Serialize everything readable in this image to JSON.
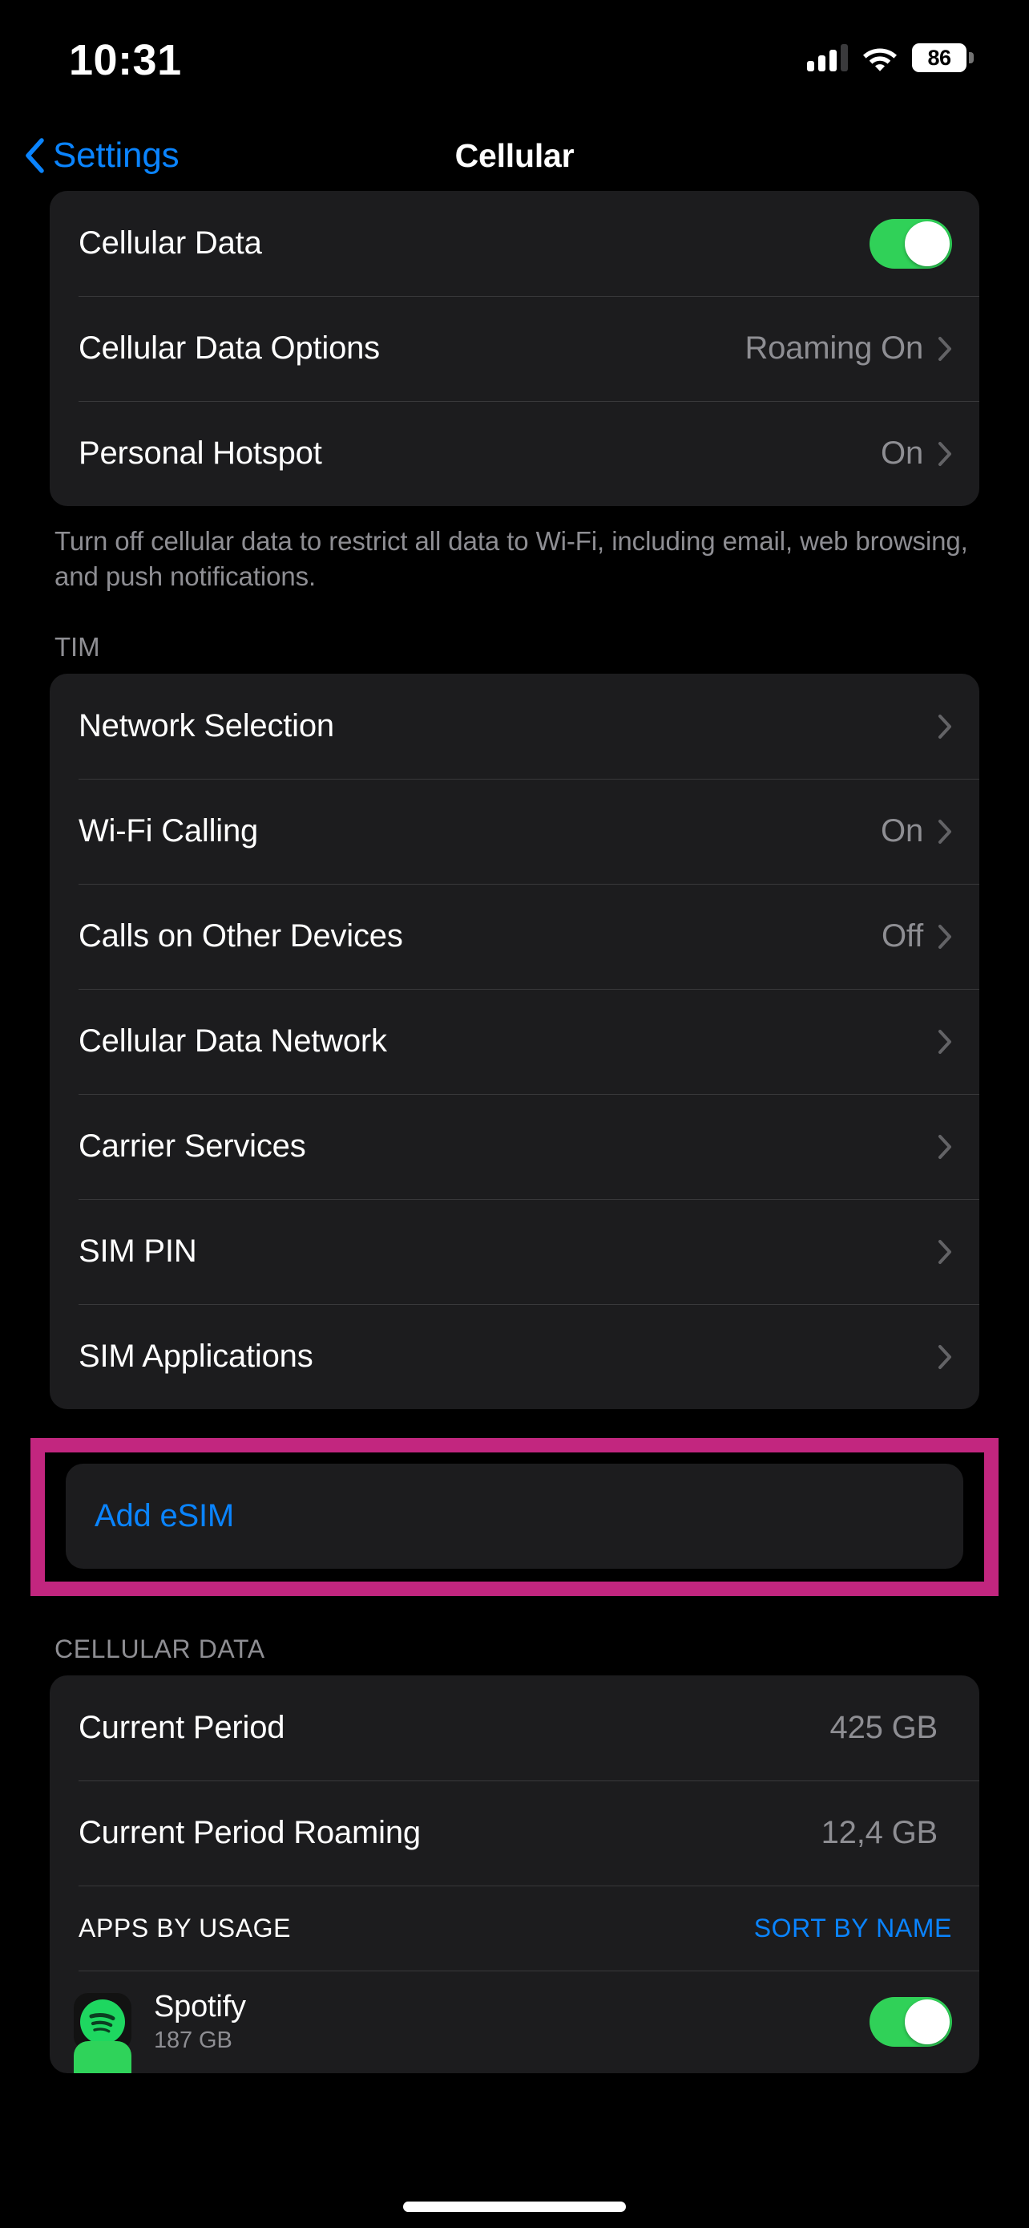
{
  "status_bar": {
    "time": "10:31",
    "battery_level": "86",
    "signal_icon": "cellular-bars-icon",
    "wifi_icon": "wifi-icon",
    "battery_icon": "battery-icon"
  },
  "nav": {
    "back_label": "Settings",
    "title": "Cellular",
    "back_icon": "chevron-left-icon"
  },
  "groups": {
    "data": {
      "rows": [
        {
          "label": "Cellular Data",
          "type": "toggle",
          "toggle_on": true
        },
        {
          "label": "Cellular Data Options",
          "value": "Roaming On",
          "type": "disclosure"
        },
        {
          "label": "Personal Hotspot",
          "value": "On",
          "type": "disclosure"
        }
      ],
      "footnote": "Turn off cellular data to restrict all data to Wi-Fi, including email, web browsing, and push notifications."
    },
    "carrier": {
      "header": "TIM",
      "rows": [
        {
          "label": "Network Selection",
          "value": "",
          "type": "disclosure"
        },
        {
          "label": "Wi-Fi Calling",
          "value": "On",
          "type": "disclosure"
        },
        {
          "label": "Calls on Other Devices",
          "value": "Off",
          "type": "disclosure"
        },
        {
          "label": "Cellular Data Network",
          "value": "",
          "type": "disclosure"
        },
        {
          "label": "Carrier Services",
          "value": "",
          "type": "disclosure"
        },
        {
          "label": "SIM PIN",
          "value": "",
          "type": "disclosure"
        },
        {
          "label": "SIM Applications",
          "value": "",
          "type": "disclosure"
        }
      ]
    },
    "add_esim": {
      "label": "Add eSIM",
      "highlight_color": "#c2267f"
    },
    "cellular_data": {
      "header": "CELLULAR DATA",
      "rows": [
        {
          "label": "Current Period",
          "value": "425 GB"
        },
        {
          "label": "Current Period Roaming",
          "value": "12,4 GB"
        }
      ],
      "usage_header": {
        "left": "APPS BY USAGE",
        "right": "SORT BY NAME"
      },
      "apps": [
        {
          "name": "Spotify",
          "size": "187 GB",
          "icon": "spotify-icon",
          "toggle_on": true
        }
      ]
    }
  },
  "colors": {
    "accent_blue": "#0a84ff",
    "toggle_green": "#30d158",
    "card_bg": "#1c1c1e",
    "secondary_text": "#8e8e93",
    "highlight_magenta": "#c2267f"
  }
}
